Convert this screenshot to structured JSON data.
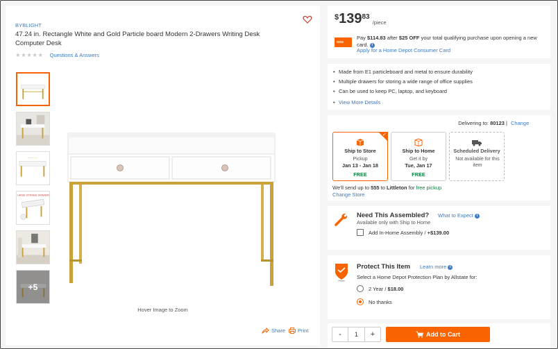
{
  "product": {
    "brand": "BYBLIGHT",
    "title": "47.24 in. Rectangle White and Gold Particle board Modern 2-Drawers Writing Desk Computer Desk",
    "stars": "★★★★★",
    "qa_link": "Questions & Answers",
    "favorite_icon": "heart-icon"
  },
  "gallery": {
    "more_count": "+5",
    "hover_text": "Hover Image to Zoom",
    "share_label": "Share",
    "print_label": "Print"
  },
  "price": {
    "currency": "$",
    "dollars": "139",
    "cents": "83",
    "unit": "/piece",
    "pay_prefix": "Pay ",
    "pay_amount": "$114.83",
    "pay_mid": " after ",
    "pay_discount": "$25 OFF",
    "pay_suffix": " your total qualifying purchase upon opening a new card. ",
    "apply_link": "Apply for a Home Depot Consumer Card"
  },
  "highlights": [
    "Made from E1 particleboard and metal to ensure durability",
    "Multiple drawers for storing a wide range of office supplies",
    "Can be used to keep PC, laptop, and keyboard"
  ],
  "view_more": "View More Details",
  "delivery": {
    "delivering_label": "Delivering to: ",
    "zip": "80123",
    "separator": " | ",
    "change_label": "Change",
    "options": [
      {
        "title": "Ship to Store",
        "line1": "Pickup",
        "line2": "Jan 13 - Jan 18",
        "price": "FREE",
        "icon": "store-box-icon",
        "state": "selected"
      },
      {
        "title": "Ship to Home",
        "line1": "Get it by",
        "line2": "Tue, Jan 17",
        "price": "FREE",
        "icon": "home-box-icon",
        "state": "normal"
      },
      {
        "title": "Scheduled Delivery",
        "line1": "Not available for this item",
        "line2": "",
        "price": "",
        "icon": "truck-icon",
        "state": "disabled"
      }
    ],
    "send_prefix": "We'll send up to ",
    "send_qty": "555",
    "send_mid": " to ",
    "send_store": "Littleton",
    "send_for": " for ",
    "send_free": "free pickup",
    "change_store": "Change Store"
  },
  "assembly": {
    "title": "Need This Assembled?",
    "what_link": "What to Expect",
    "subtitle": "Available only with Ship to Home",
    "option_label": "Add In-Home Assembly / ",
    "option_price": "+$139.00"
  },
  "protection": {
    "title": "Protect This Item",
    "learn_link": "Learn more",
    "subtitle": "Select a Home Depot Protection Plan by Allstate for:",
    "plans": [
      {
        "label": "2 Year / ",
        "price": "$18.00",
        "selected": false
      },
      {
        "label": "No thanks",
        "price": "",
        "selected": true
      }
    ]
  },
  "cart": {
    "minus": "-",
    "quantity": "1",
    "plus": "+",
    "button_label": "Add to Cart"
  },
  "colors": {
    "brand_orange": "#f96302",
    "link_blue": "#3e7ac2",
    "free_green": "#00873c",
    "desk_gold": "#c9a33a"
  }
}
